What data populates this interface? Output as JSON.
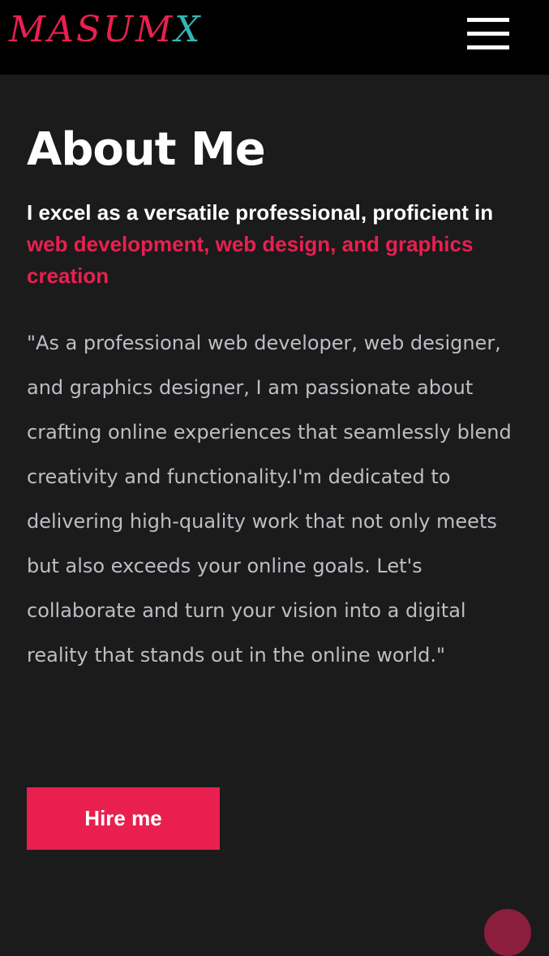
{
  "navbar": {
    "logo_main": "MASUM",
    "logo_accent": "X",
    "menu_icon": "hamburger-menu-icon",
    "colors": {
      "background": "#000000",
      "logo_main": "#e9204f",
      "logo_accent": "#35b6b4"
    }
  },
  "about": {
    "title": "About Me",
    "subtitle_prefix": "I excel as a versatile professional, proficient in ",
    "subtitle_highlight": "web development, web design, and graphics creation",
    "body": "\"As a professional web developer, web designer, and graphics designer, I am passionate about crafting online experiences that seamlessly blend creativity and functionality.I'm dedicated to delivering high-quality work that not only meets but also exceeds your online goals. Let's collaborate and turn your vision into a digital reality that stands out in the online world.\"",
    "hire_button_label": "Hire me"
  },
  "scroll_top_icon": "scroll-to-top-icon",
  "colors": {
    "page_background": "#1b1b1c",
    "accent": "#e9204f",
    "body_text": "#bdbdc3",
    "heading_text": "#ffffff"
  }
}
